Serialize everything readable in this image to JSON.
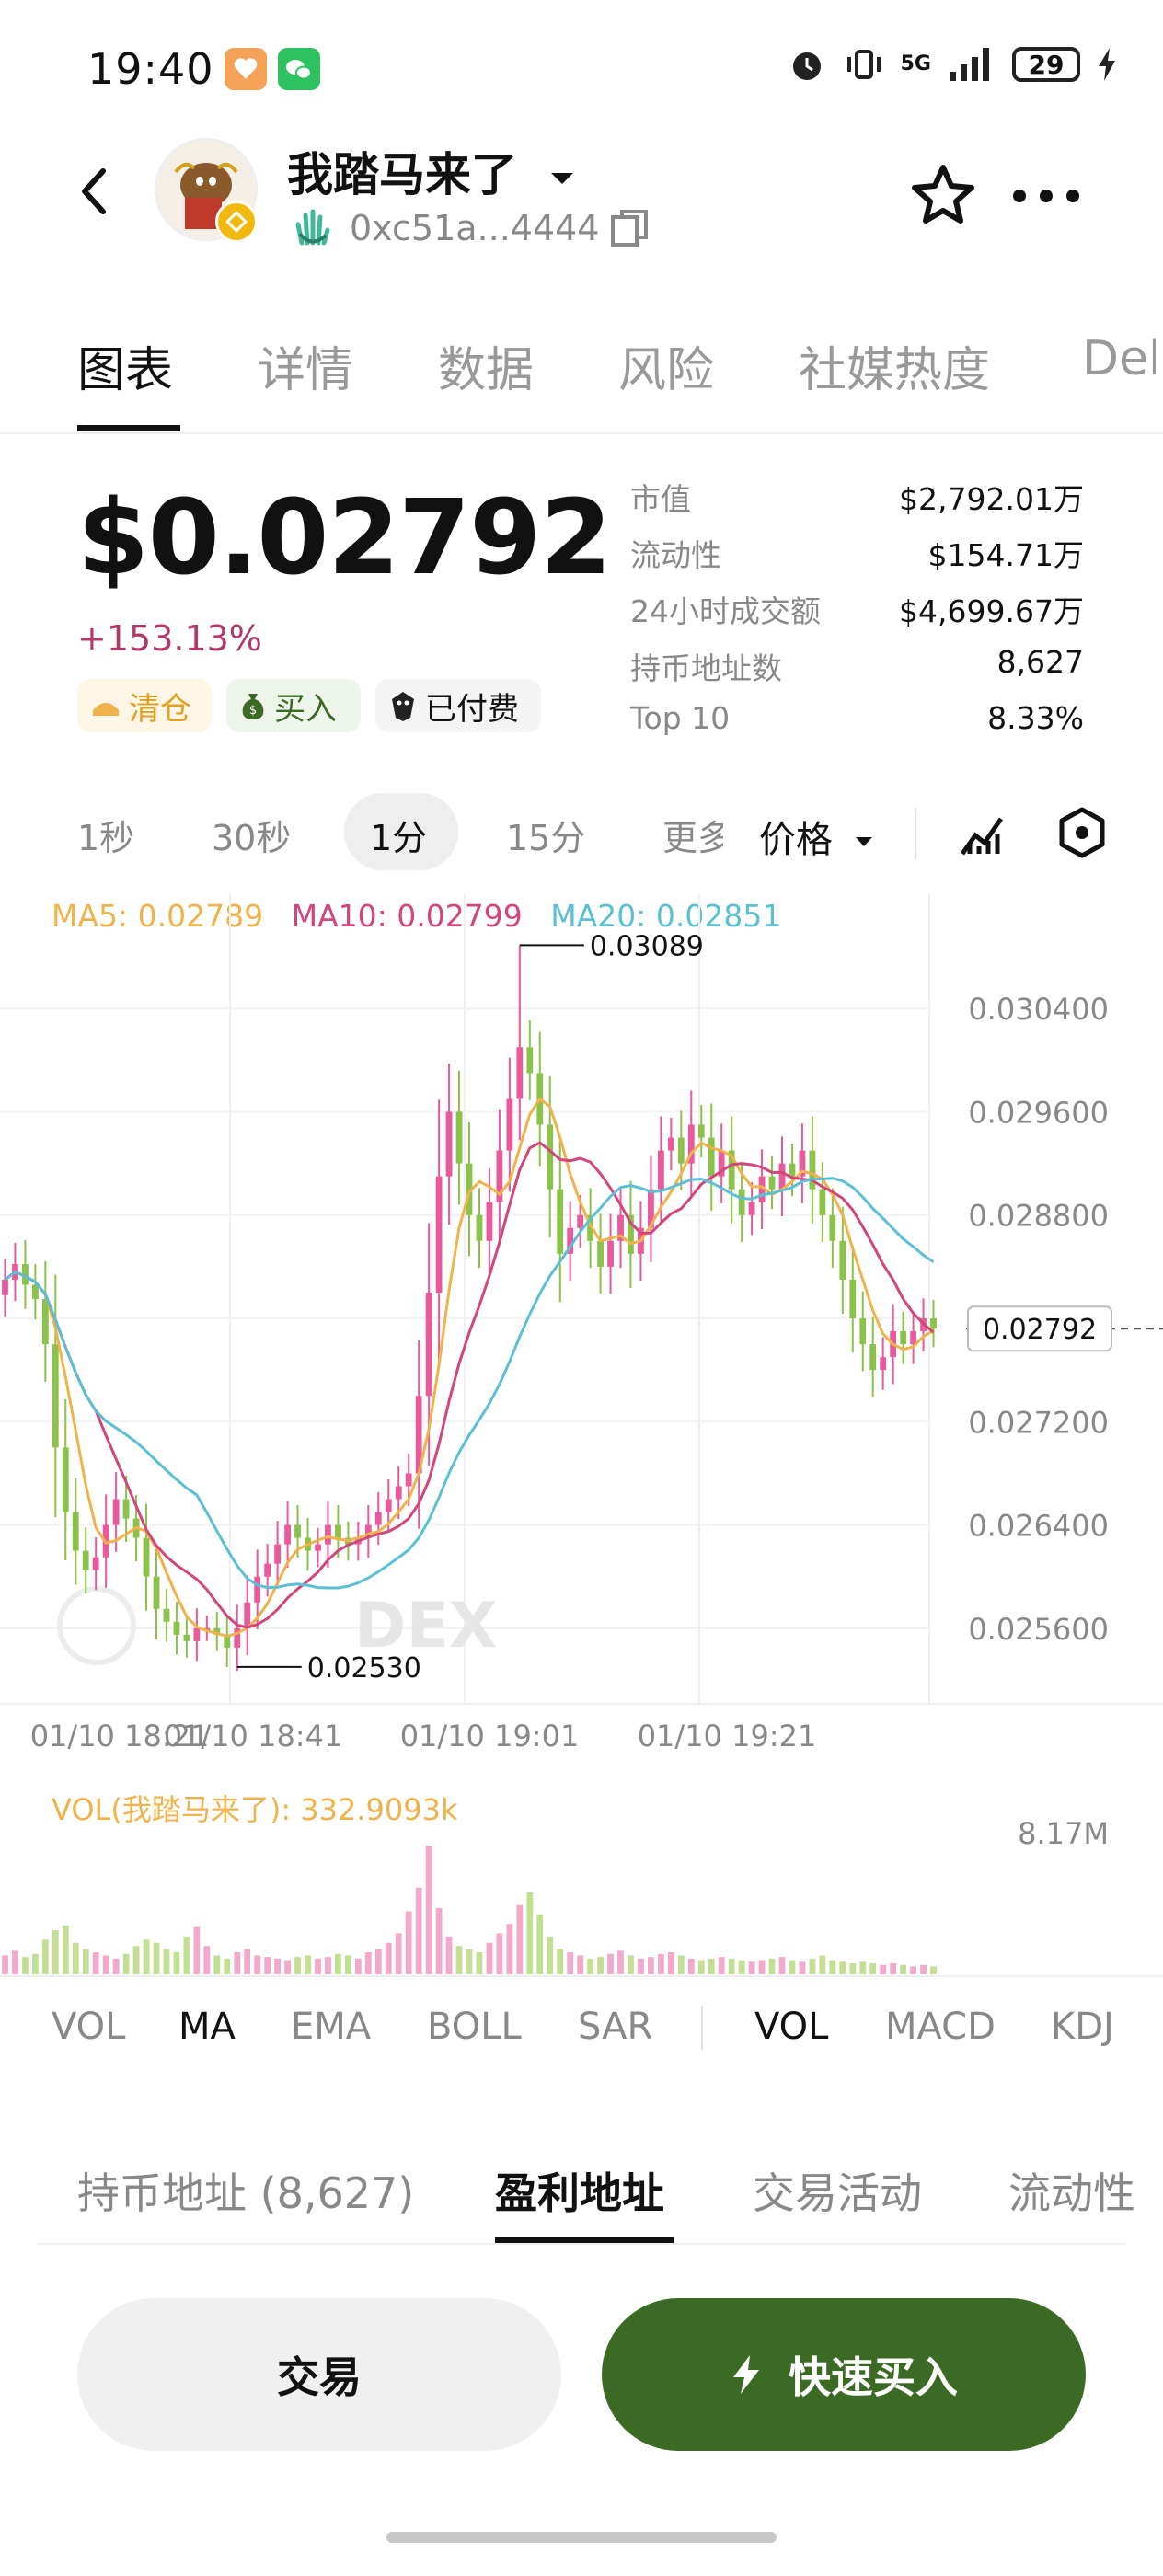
{
  "status_bar": {
    "time": "19:40",
    "battery": "29",
    "network": "5G"
  },
  "header": {
    "token_name": "我踏马来了",
    "address": "0xc51a...4444"
  },
  "tabs": [
    {
      "label": "图表"
    },
    {
      "label": "详情"
    },
    {
      "label": "数据"
    },
    {
      "label": "风险"
    },
    {
      "label": "社媒热度"
    },
    {
      "label": "Del"
    }
  ],
  "price": {
    "value": "$0.02792",
    "change": "+153.13%"
  },
  "pills": [
    {
      "label": "清仓"
    },
    {
      "label": "买入"
    },
    {
      "label": "已付费"
    }
  ],
  "stats": [
    {
      "label": "市值",
      "value": "$2,792.01万"
    },
    {
      "label": "流动性",
      "value": "$154.71万"
    },
    {
      "label": "24小时成交额",
      "value": "$4,699.67万"
    },
    {
      "label": "持币地址数",
      "value": "8,627"
    },
    {
      "label": "Top 10",
      "value": "8.33%"
    }
  ],
  "timeframes": [
    {
      "label": "1秒"
    },
    {
      "label": "30秒"
    },
    {
      "label": "1分"
    },
    {
      "label": "15分"
    },
    {
      "label": "更多"
    }
  ],
  "chart_mode": "价格",
  "ma_legend": {
    "ma5": "MA5: 0.02789",
    "ma10": "MA10: 0.02799",
    "ma20": "MA20: 0.02851"
  },
  "colors": {
    "up": "#e85a9b",
    "down": "#8bc34a",
    "ma5": "#f0b24a",
    "ma10": "#d2457d",
    "ma20": "#5bbfd6",
    "primary": "#3b6a25"
  },
  "chart_data": {
    "type": "candlestick",
    "y_ticks": [
      "0.030400",
      "0.029600",
      "0.028800",
      "0.028000",
      "0.027200",
      "0.026400",
      "0.025600"
    ],
    "x_ticks": [
      "01/10 18:21",
      "01/10 18:41",
      "01/10 19:01",
      "01/10 19:21"
    ],
    "high_label": "0.03089",
    "low_label": "0.02530",
    "current_label": "0.02792",
    "watermark": "DEX",
    "volume_label": "VOL(我踏马来了): 332.9093k",
    "volume_max": "8.17M",
    "ylim": [
      0.0251,
      0.031
    ],
    "closes": [
      0.0283,
      0.02842,
      0.02826,
      0.02815,
      0.0278,
      0.027,
      0.0265,
      0.0262,
      0.02605,
      0.02615,
      0.0264,
      0.0266,
      0.02645,
      0.0263,
      0.026,
      0.02575,
      0.02565,
      0.02555,
      0.0255,
      0.0256,
      0.0256,
      0.02555,
      0.02545,
      0.0256,
      0.0258,
      0.026,
      0.0261,
      0.02625,
      0.0264,
      0.0263,
      0.0262,
      0.02625,
      0.0264,
      0.0263,
      0.02625,
      0.0263,
      0.0264,
      0.0265,
      0.0266,
      0.0267,
      0.0268,
      0.0274,
      0.0282,
      0.0291,
      0.0296,
      0.0292,
      0.0288,
      0.0286,
      0.0289,
      0.0293,
      0.0297,
      0.0301,
      0.0299,
      0.0295,
      0.029,
      0.0285,
      0.0287,
      0.0288,
      0.0286,
      0.0284,
      0.0286,
      0.0288,
      0.0285,
      0.0287,
      0.029,
      0.0293,
      0.0294,
      0.0292,
      0.0295,
      0.0294,
      0.0291,
      0.0293,
      0.029,
      0.0288,
      0.0289,
      0.0291,
      0.029,
      0.0292,
      0.0291,
      0.0293,
      0.029,
      0.0288,
      0.0286,
      0.0283,
      0.028,
      0.0278,
      0.0276,
      0.0277,
      0.0279,
      0.0278,
      0.0279,
      0.028,
      0.02792
    ],
    "volumes": [
      1.2,
      1.5,
      1.1,
      1.3,
      2.2,
      2.8,
      3.1,
      2.0,
      1.6,
      1.4,
      1.2,
      1.0,
      1.3,
      1.8,
      2.2,
      2.0,
      1.6,
      1.4,
      2.4,
      3.0,
      1.8,
      1.2,
      1.0,
      1.4,
      1.6,
      1.2,
      1.1,
      1.0,
      0.9,
      1.1,
      1.2,
      1.0,
      1.1,
      1.3,
      1.2,
      1.0,
      1.4,
      1.6,
      2.0,
      2.6,
      4.0,
      5.5,
      8.17,
      4.2,
      2.4,
      1.8,
      1.6,
      1.4,
      2.0,
      2.6,
      3.2,
      4.4,
      5.2,
      3.8,
      2.4,
      1.6,
      1.4,
      1.2,
      1.0,
      1.1,
      1.3,
      1.5,
      1.2,
      1.0,
      1.1,
      1.3,
      1.4,
      1.2,
      1.0,
      0.9,
      1.0,
      1.1,
      1.0,
      0.9,
      0.8,
      0.9,
      1.0,
      1.1,
      0.9,
      0.8,
      1.0,
      1.2,
      0.9,
      0.8,
      0.7,
      0.8,
      0.7,
      0.6,
      0.7,
      0.6,
      0.5,
      0.6,
      0.5
    ]
  },
  "indicators_left": [
    {
      "label": "VOL"
    },
    {
      "label": "MA"
    },
    {
      "label": "EMA"
    },
    {
      "label": "BOLL"
    },
    {
      "label": "SAR"
    }
  ],
  "indicators_right": [
    {
      "label": "VOL"
    },
    {
      "label": "MACD"
    },
    {
      "label": "KDJ"
    }
  ],
  "bottom_tabs": [
    {
      "label": "持币地址 (8,627)"
    },
    {
      "label": "盈利地址"
    },
    {
      "label": "交易活动"
    },
    {
      "label": "流动性"
    }
  ],
  "actions": {
    "trade": "交易",
    "quick_buy": "快速买入"
  }
}
